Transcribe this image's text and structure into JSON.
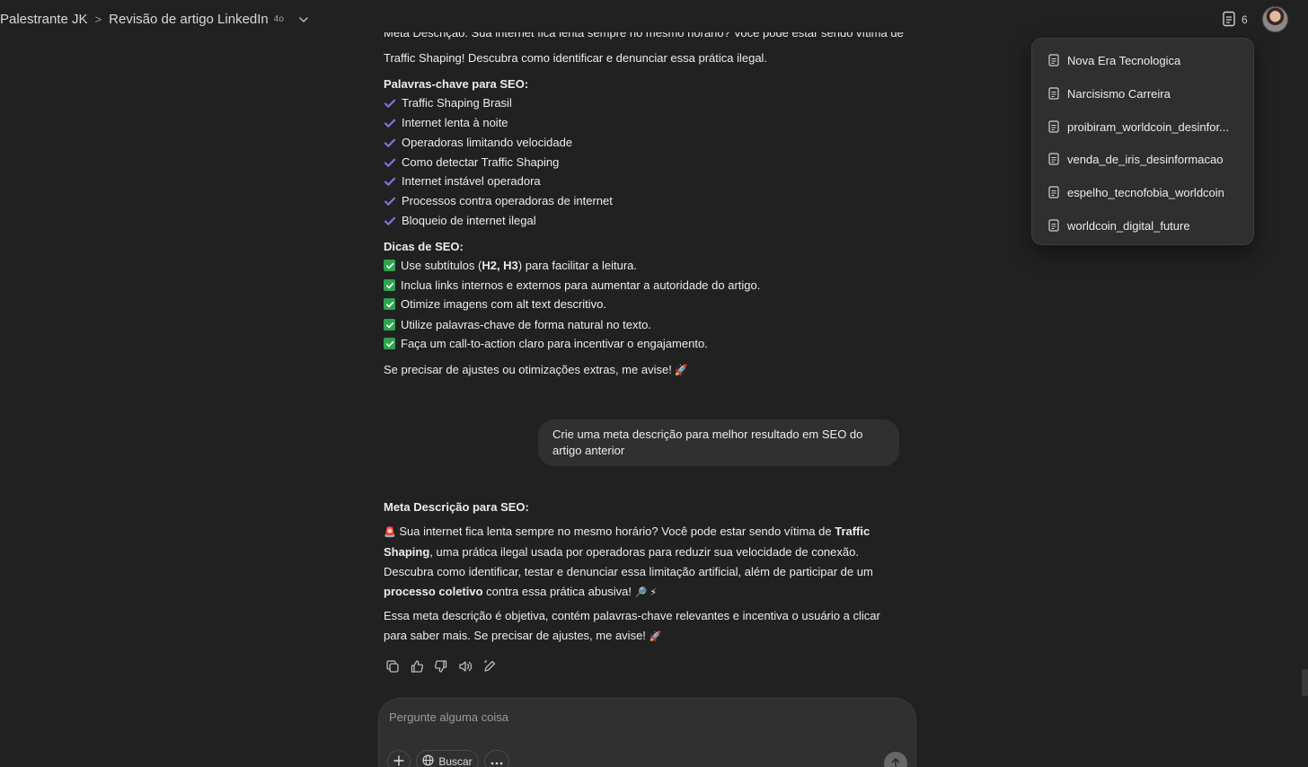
{
  "header": {
    "project": "Palestrante JK",
    "separator": ">",
    "chat_title": "Revisão de artigo LinkedIn",
    "model": "4o",
    "docs_count": "6"
  },
  "docs_panel": {
    "items": [
      {
        "label": "Nova Era Tecnologica"
      },
      {
        "label": "Narcisismo Carreira"
      },
      {
        "label": "proibiram_worldcoin_desinfor..."
      },
      {
        "label": "venda_de_iris_desinformacao"
      },
      {
        "label": "espelho_tecnofobia_worldcoin"
      },
      {
        "label": "worldcoin_digital_future"
      }
    ]
  },
  "assistant_prev": {
    "partial_line_top": "Meta Descrição: Sua internet fica lenta sempre no mesmo horário? Você pode estar sendo vítima de",
    "partial_line_2": "Traffic Shaping! Descubra como identificar e denunciar essa prática ilegal.",
    "keywords_heading": "Palavras-chave para SEO:",
    "keywords": [
      "Traffic Shaping Brasil",
      "Internet lenta à noite",
      "Operadoras limitando velocidade",
      "Como detectar Traffic Shaping",
      "Internet instável operadora",
      "Processos contra operadoras de internet",
      "Bloqueio de internet ilegal"
    ],
    "tips_heading": "Dicas de SEO:",
    "tips": [
      {
        "pre": "Use subtítulos (",
        "bold": "H2, H3",
        "post": ") para facilitar a leitura."
      },
      {
        "pre": "Inclua links internos e externos para aumentar a autoridade do artigo.",
        "bold": "",
        "post": ""
      },
      {
        "pre": "Otimize imagens com alt text descritivo.",
        "bold": "",
        "post": ""
      },
      {
        "pre": "Utilize palavras-chave de forma natural no texto.",
        "bold": "",
        "post": ""
      },
      {
        "pre": "Faça um call-to-action claro para incentivar o engajamento.",
        "bold": "",
        "post": ""
      }
    ],
    "closing": "Se precisar de ajustes ou otimizações extras, me avise!",
    "closing_emoji": "🚀"
  },
  "user_message": "Crie uma meta descrição para melhor resultado em SEO do artigo anterior",
  "assistant_reply": {
    "heading": "Meta Descrição para SEO:",
    "p1_emoji": "🚨",
    "p1_a": "Sua internet fica lenta sempre no mesmo horário? Você pode estar sendo vítima de ",
    "p1_bold1": "Traffic Shaping",
    "p1_b": ", uma prática ilegal usada por operadoras para reduzir sua velocidade de conexão. Descubra como identificar, testar e denunciar essa limitação artificial, além de participar de um ",
    "p1_bold2": "processo coletivo",
    "p1_c": " contra essa prática abusiva!",
    "p1_end_emojis": "🔎 ⚡",
    "p2": "Essa meta descrição é objetiva, contém palavras-chave relevantes e incentiva o usuário a clicar para saber mais. Se precisar de ajustes, me avise!",
    "p2_emoji": "🚀"
  },
  "composer": {
    "placeholder": "Pergunte alguma coisa",
    "search_label": "Buscar"
  }
}
